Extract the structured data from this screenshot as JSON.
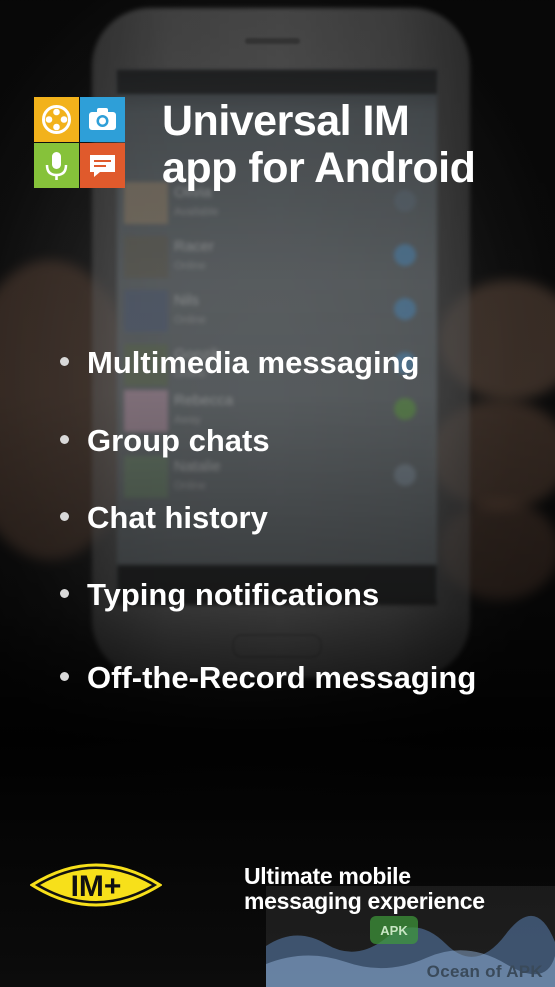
{
  "screen": {
    "heading_line1": "Universal IM",
    "heading_line2": "app for Android"
  },
  "features": [
    "Multimedia messaging",
    "Group chats",
    "Chat history",
    "Typing notifications",
    "Off-the-Record messaging"
  ],
  "tagline": {
    "line1": "Ultimate mobile",
    "line2": "messaging experience"
  },
  "logo": {
    "text": "IM+"
  },
  "background_contacts": [
    {
      "name": "Olivia",
      "status": "Available"
    },
    {
      "name": "Racer",
      "status": "Online"
    },
    {
      "name": "Nils",
      "status": "Online"
    },
    {
      "name": "Gonzik",
      "status": "Online"
    },
    {
      "name": "Rebecca",
      "status": "Away"
    },
    {
      "name": "Natalie",
      "status": "Online"
    }
  ],
  "watermark": {
    "caption": "Ocean of APK",
    "badge": "APK"
  },
  "colors": {
    "tile_yellow": "#f2b21b",
    "tile_blue": "#2e9fd8",
    "tile_green": "#86c23a",
    "tile_orange": "#e05a2c",
    "logo_yellow": "#f7e01a"
  }
}
